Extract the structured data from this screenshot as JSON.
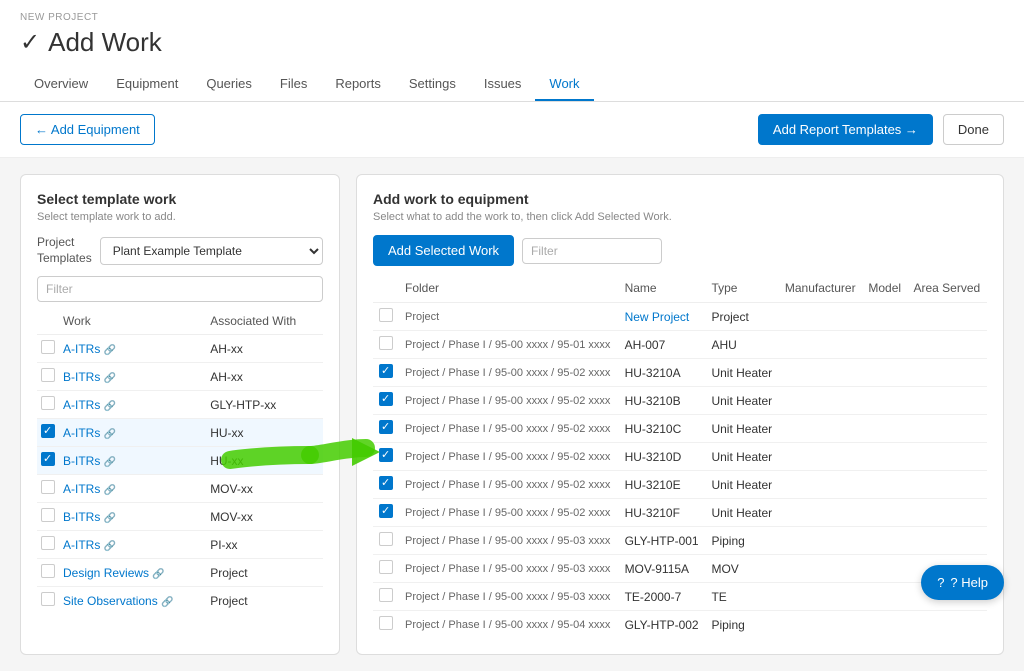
{
  "header": {
    "breadcrumb": "New Project",
    "title": "Add Work",
    "checkmark": "✓"
  },
  "nav": {
    "tabs": [
      {
        "label": "Overview",
        "active": false
      },
      {
        "label": "Equipment",
        "active": false
      },
      {
        "label": "Queries",
        "active": false
      },
      {
        "label": "Files",
        "active": false
      },
      {
        "label": "Reports",
        "active": false
      },
      {
        "label": "Settings",
        "active": false
      },
      {
        "label": "Issues",
        "active": false
      },
      {
        "label": "Work",
        "active": true
      }
    ]
  },
  "toolbar": {
    "add_equipment_label": "← Add Equipment",
    "add_report_label": "Add Report Templates →",
    "done_label": "Done"
  },
  "left_panel": {
    "title": "Select template work",
    "subtitle": "Select template work to add.",
    "template_label": "Project\nTemplates",
    "template_option": "Plant Example Template",
    "filter_placeholder": "Filter",
    "col_work": "Work",
    "col_associated": "Associated With",
    "rows": [
      {
        "work": "A-ITRs",
        "associated": "AH-xx",
        "checked": false
      },
      {
        "work": "B-ITRs",
        "associated": "AH-xx",
        "checked": false
      },
      {
        "work": "A-ITRs",
        "associated": "GLY-HTP-xx",
        "checked": false
      },
      {
        "work": "A-ITRs",
        "associated": "HU-xx",
        "checked": true,
        "highlighted": true
      },
      {
        "work": "B-ITRs",
        "associated": "HU-xx",
        "checked": true,
        "highlighted": true
      },
      {
        "work": "A-ITRs",
        "associated": "MOV-xx",
        "checked": false
      },
      {
        "work": "B-ITRs",
        "associated": "MOV-xx",
        "checked": false
      },
      {
        "work": "A-ITRs",
        "associated": "PI-xx",
        "checked": false
      },
      {
        "work": "Design Reviews",
        "associated": "Project",
        "checked": false
      },
      {
        "work": "Site Observations",
        "associated": "Project",
        "checked": false
      }
    ]
  },
  "right_panel": {
    "title": "Add work to equipment",
    "subtitle": "Select what to add the work to, then click Add Selected Work.",
    "add_selected_label": "Add Selected Work",
    "filter_placeholder": "Filter",
    "cols": [
      "Folder",
      "Name",
      "Type",
      "Manufacturer",
      "Model",
      "Area Served"
    ],
    "rows": [
      {
        "folder": "Project",
        "name": "New Project",
        "type": "Project",
        "manufacturer": "",
        "model": "",
        "area": "",
        "checked": false,
        "is_project": true
      },
      {
        "folder": "Project / Phase I / 95-00 xxxx / 95-01 xxxx",
        "name": "AH-007",
        "type": "AHU",
        "manufacturer": "",
        "model": "",
        "area": "",
        "checked": false
      },
      {
        "folder": "Project / Phase I / 95-00 xxxx / 95-02 xxxx",
        "name": "HU-3210A",
        "type": "Unit Heater",
        "manufacturer": "",
        "model": "",
        "area": "",
        "checked": true
      },
      {
        "folder": "Project / Phase I / 95-00 xxxx / 95-02 xxxx",
        "name": "HU-3210B",
        "type": "Unit Heater",
        "manufacturer": "",
        "model": "",
        "area": "",
        "checked": true
      },
      {
        "folder": "Project / Phase I / 95-00 xxxx / 95-02 xxxx",
        "name": "HU-3210C",
        "type": "Unit Heater",
        "manufacturer": "",
        "model": "",
        "area": "",
        "checked": true
      },
      {
        "folder": "Project / Phase I / 95-00 xxxx / 95-02 xxxx",
        "name": "HU-3210D",
        "type": "Unit Heater",
        "manufacturer": "",
        "model": "",
        "area": "",
        "checked": true
      },
      {
        "folder": "Project / Phase I / 95-00 xxxx / 95-02 xxxx",
        "name": "HU-3210E",
        "type": "Unit Heater",
        "manufacturer": "",
        "model": "",
        "area": "",
        "checked": true
      },
      {
        "folder": "Project / Phase I / 95-00 xxxx / 95-02 xxxx",
        "name": "HU-3210F",
        "type": "Unit Heater",
        "manufacturer": "",
        "model": "",
        "area": "",
        "checked": true
      },
      {
        "folder": "Project / Phase I / 95-00 xxxx / 95-03 xxxx",
        "name": "GLY-HTP-001",
        "type": "Piping",
        "manufacturer": "",
        "model": "",
        "area": "",
        "checked": false
      },
      {
        "folder": "Project / Phase I / 95-00 xxxx / 95-03 xxxx",
        "name": "MOV-9115A",
        "type": "MOV",
        "manufacturer": "",
        "model": "",
        "area": "",
        "checked": false
      },
      {
        "folder": "Project / Phase I / 95-00 xxxx / 95-03 xxxx",
        "name": "TE-2000-7",
        "type": "TE",
        "manufacturer": "",
        "model": "",
        "area": "",
        "checked": false
      },
      {
        "folder": "Project / Phase I / 95-00 xxxx / 95-04 xxxx",
        "name": "GLY-HTP-002",
        "type": "Piping",
        "manufacturer": "",
        "model": "",
        "area": "",
        "checked": false
      }
    ]
  },
  "help": {
    "label": "? Help"
  }
}
